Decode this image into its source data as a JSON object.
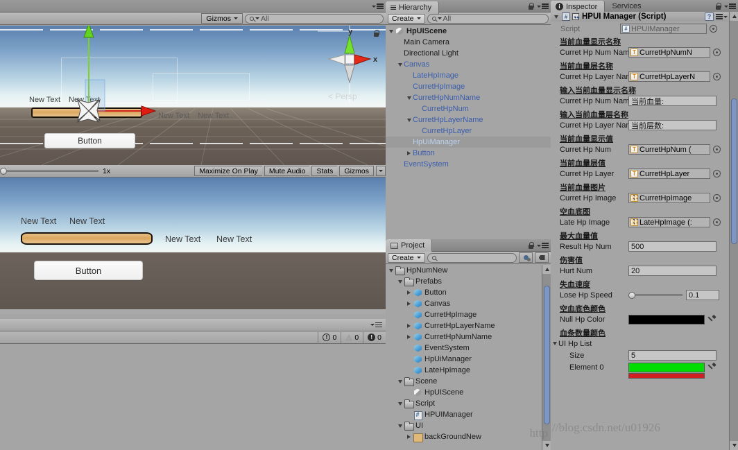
{
  "scene_view": {
    "gizmos_label": "Gizmos",
    "search_placeholder": "All",
    "axis_gizmo": {
      "persp_label": "Persp",
      "x_label": "x",
      "y_label": "y"
    },
    "texts": [
      "New Text",
      "New Text",
      "New Text",
      "New Text"
    ],
    "button_label": "Button"
  },
  "game_view": {
    "scale_label": "1x",
    "maximize_on_play": "Maximize On Play",
    "mute_audio": "Mute Audio",
    "stats": "Stats",
    "gizmos": "Gizmos",
    "texts": [
      "New Text",
      "New Text",
      "New Text",
      "New Text"
    ],
    "button_label": "Button"
  },
  "console": {
    "error_count": "0",
    "warning_count": "0",
    "log_count": "0"
  },
  "hierarchy": {
    "tab_label": "Hierarchy",
    "create_label": "Create",
    "search_placeholder": "All",
    "items": [
      {
        "label": "HpUIScene",
        "indent": 0,
        "arrow": "down",
        "icon": "unity",
        "blue": false,
        "selected": false,
        "bold": true
      },
      {
        "label": "Main Camera",
        "indent": 1,
        "arrow": "none",
        "icon": "none",
        "blue": false,
        "selected": false
      },
      {
        "label": "Directional Light",
        "indent": 1,
        "arrow": "none",
        "icon": "none",
        "blue": false,
        "selected": false
      },
      {
        "label": "Canvas",
        "indent": 1,
        "arrow": "down",
        "icon": "none",
        "blue": true,
        "selected": false
      },
      {
        "label": "LateHpImage",
        "indent": 2,
        "arrow": "none",
        "icon": "none",
        "blue": true,
        "selected": false
      },
      {
        "label": "CurretHpImage",
        "indent": 2,
        "arrow": "none",
        "icon": "none",
        "blue": true,
        "selected": false
      },
      {
        "label": "CurretHpNumName",
        "indent": 2,
        "arrow": "down",
        "icon": "none",
        "blue": true,
        "selected": false
      },
      {
        "label": "CurretHpNum",
        "indent": 3,
        "arrow": "none",
        "icon": "none",
        "blue": true,
        "selected": false
      },
      {
        "label": "CurretHpLayerName",
        "indent": 2,
        "arrow": "down",
        "icon": "none",
        "blue": true,
        "selected": false
      },
      {
        "label": "CurretHpLayer",
        "indent": 3,
        "arrow": "none",
        "icon": "none",
        "blue": true,
        "selected": false
      },
      {
        "label": "HpUiManager",
        "indent": 2,
        "arrow": "none",
        "icon": "none",
        "blue": true,
        "selected": true
      },
      {
        "label": "Button",
        "indent": 2,
        "arrow": "right",
        "icon": "none",
        "blue": true,
        "selected": false
      },
      {
        "label": "EventSystem",
        "indent": 1,
        "arrow": "none",
        "icon": "none",
        "blue": true,
        "selected": false
      }
    ]
  },
  "project": {
    "tab_label": "Project",
    "create_label": "Create",
    "search_placeholder": "",
    "items": [
      {
        "label": "HpNumNew",
        "indent": 0,
        "arrow": "down",
        "icon": "folder"
      },
      {
        "label": "Prefabs",
        "indent": 1,
        "arrow": "down",
        "icon": "folder"
      },
      {
        "label": "Button",
        "indent": 2,
        "arrow": "right",
        "icon": "prefab"
      },
      {
        "label": "Canvas",
        "indent": 2,
        "arrow": "right",
        "icon": "prefab"
      },
      {
        "label": "CurretHpImage",
        "indent": 2,
        "arrow": "none",
        "icon": "prefab"
      },
      {
        "label": "CurretHpLayerName",
        "indent": 2,
        "arrow": "right",
        "icon": "prefab"
      },
      {
        "label": "CurretHpNumName",
        "indent": 2,
        "arrow": "right",
        "icon": "prefab"
      },
      {
        "label": "EventSystem",
        "indent": 2,
        "arrow": "none",
        "icon": "prefab"
      },
      {
        "label": "HpUiManager",
        "indent": 2,
        "arrow": "none",
        "icon": "prefab"
      },
      {
        "label": "LateHpImage",
        "indent": 2,
        "arrow": "none",
        "icon": "prefab"
      },
      {
        "label": "Scene",
        "indent": 1,
        "arrow": "down",
        "icon": "folder"
      },
      {
        "label": "HpUIScene",
        "indent": 2,
        "arrow": "none",
        "icon": "unity"
      },
      {
        "label": "Script",
        "indent": 1,
        "arrow": "down",
        "icon": "folder"
      },
      {
        "label": "HPUIManager",
        "indent": 2,
        "arrow": "none",
        "icon": "cs"
      },
      {
        "label": "UI",
        "indent": 1,
        "arrow": "down",
        "icon": "folder"
      },
      {
        "label": "backGroundNew",
        "indent": 2,
        "arrow": "right",
        "icon": "tex"
      }
    ]
  },
  "inspector": {
    "tab_label": "Inspector",
    "services_tab_label": "Services",
    "component_title": "HPUI Manager (Script)",
    "script_label": "Script",
    "script_value": "HPUIManager",
    "fields": [
      {
        "cn": "当前血量显示名称",
        "label": "Curret Hp Num Nam",
        "type": "object",
        "value": "CurretHpNumN",
        "icon": "text"
      },
      {
        "cn": "当前血量层名称",
        "label": "Curret Hp Layer Nan",
        "type": "object",
        "value": "CurretHpLayerN",
        "icon": "text"
      },
      {
        "cn": "输入当前血量显示名称",
        "label": "Curret Hp Num Nam",
        "type": "text",
        "value": "当前血量:"
      },
      {
        "cn": "输入当前血量层名称",
        "label": "Curret Hp Layer Nan",
        "type": "text",
        "value": "当前层数:"
      },
      {
        "cn": "当前血量显示值",
        "label": "Curret Hp Num",
        "type": "object",
        "value": "CurretHpNum (",
        "icon": "text"
      },
      {
        "cn": "当前血量层值",
        "label": "Curret Hp Layer",
        "type": "object",
        "value": "CurretHpLayer",
        "icon": "text"
      },
      {
        "cn": "当前血量图片",
        "label": "Curret Hp Image",
        "type": "object",
        "value": "CurretHpImage",
        "icon": "image"
      },
      {
        "cn": "空血底图",
        "label": "Late Hp Image",
        "type": "object",
        "value": "LateHpImage (:",
        "icon": "image"
      },
      {
        "cn": "最大血量值",
        "label": "Result Hp Num",
        "type": "text",
        "value": "500"
      },
      {
        "cn": "伤害值",
        "label": "Hurt Num",
        "type": "text",
        "value": "20"
      },
      {
        "cn": "失血速度",
        "label": "Lose Hp Speed",
        "type": "slider",
        "value": "0.1"
      },
      {
        "cn": "空血底色颜色",
        "label": "Null Hp Color",
        "type": "color",
        "value": "#000000"
      }
    ],
    "list": {
      "cn": "血条数量颜色",
      "title": "UI Hp List",
      "size_label": "Size",
      "size_value": "5",
      "element0_label": "Element 0",
      "element0_color": "#00dd00",
      "element1_color": "#d02020"
    }
  },
  "watermark": {
    "inspector_text": "//blog.csdn.net/u01926",
    "project_text": "http"
  }
}
